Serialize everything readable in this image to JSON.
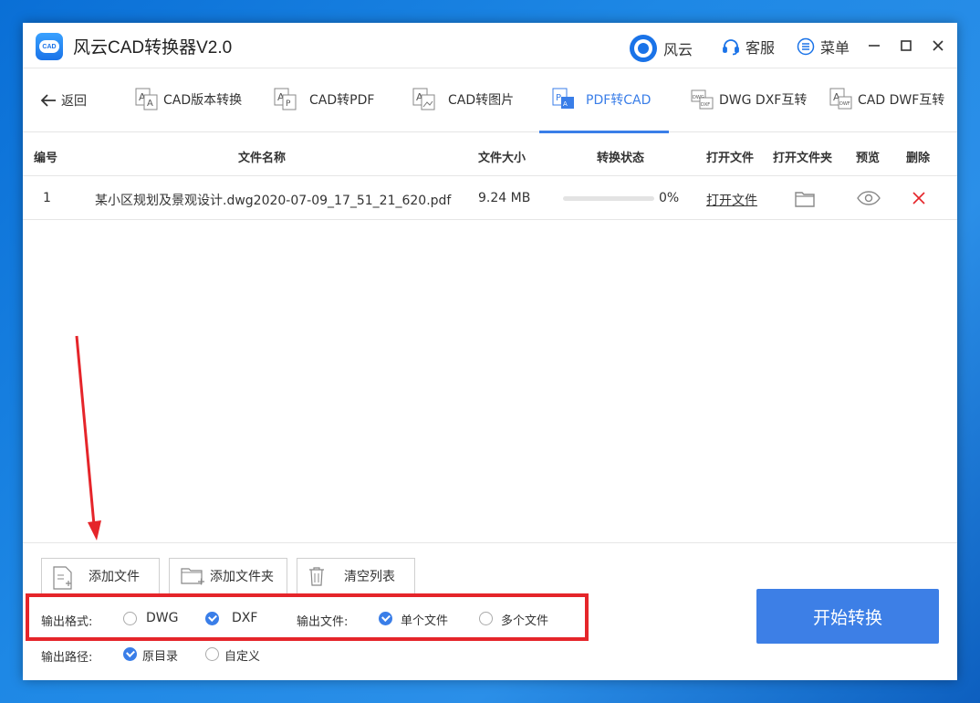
{
  "app": {
    "title": "风云CAD转换器V2.0",
    "logo_text": "CAD"
  },
  "titlebar": {
    "brand_label": "风云",
    "support_label": "客服",
    "menu_label": "菜单"
  },
  "nav": {
    "back_label": "返回",
    "tabs": [
      {
        "label": "CAD版本转换"
      },
      {
        "label": "CAD转PDF"
      },
      {
        "label": "CAD转图片"
      },
      {
        "label": "PDF转CAD"
      },
      {
        "label": "DWG DXF互转"
      },
      {
        "label": "CAD DWF互转"
      }
    ],
    "active_tab": "PDF转CAD"
  },
  "table": {
    "headers": [
      "编号",
      "文件名称",
      "文件大小",
      "转换状态",
      "打开文件",
      "打开文件夹",
      "预览",
      "删除"
    ],
    "rows": [
      {
        "index": "1",
        "name": "某小区规划及景观设计.dwg2020-07-09_17_51_21_620.pdf",
        "size": "9.24 MB",
        "progress_text": "0%",
        "progress": 0,
        "open_file": "打开文件"
      }
    ]
  },
  "actions": {
    "add_file": "添加文件",
    "add_folder": "添加文件夹",
    "clear_list": "清空列表"
  },
  "options": {
    "format_label": "输出格式:",
    "format_dwg": "DWG",
    "format_dxf": "DXF",
    "format_selected": "DXF",
    "file_label": "输出文件:",
    "file_single": "单个文件",
    "file_multi": "多个文件",
    "file_selected": "单个文件",
    "path_label": "输出路径:",
    "path_original": "原目录",
    "path_custom": "自定义",
    "path_selected": "原目录"
  },
  "start_button": "开始转换",
  "colors": {
    "accent": "#3a7ee8",
    "annotation": "#e5252a",
    "desktop": "#1e88e5"
  }
}
